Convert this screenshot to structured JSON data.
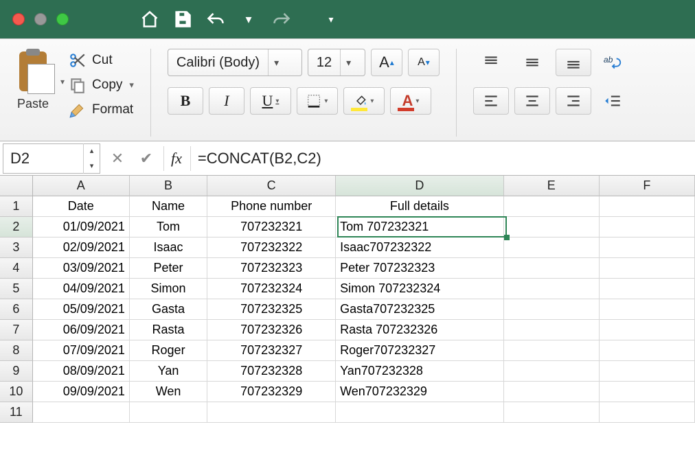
{
  "titlebar": {},
  "ribbon": {
    "paste_label": "Paste",
    "cut_label": "Cut",
    "copy_label": "Copy",
    "format_label": "Format",
    "font_name": "Calibri (Body)",
    "font_size": "12",
    "bold": "B",
    "italic": "I",
    "underline": "U",
    "font_color_letter": "A",
    "increase_A": "A",
    "decrease_A": "A"
  },
  "formula_bar": {
    "name_box": "D2",
    "fx_label": "fx",
    "formula": "=CONCAT(B2,C2)"
  },
  "grid": {
    "columns": [
      "A",
      "B",
      "C",
      "D",
      "E",
      "F"
    ],
    "active_column_index": 3,
    "active_row": 2,
    "selected_cell": "D2",
    "headers": {
      "A": "Date",
      "B": "Name",
      "C": "Phone number",
      "D": "Full details",
      "E": "",
      "F": ""
    },
    "rows": [
      {
        "n": 1
      },
      {
        "n": 2,
        "A": "01/09/2021",
        "B": "Tom",
        "C": "707232321",
        "D": "Tom 707232321"
      },
      {
        "n": 3,
        "A": "02/09/2021",
        "B": "Isaac",
        "C": "707232322",
        "D": "Isaac707232322"
      },
      {
        "n": 4,
        "A": "03/09/2021",
        "B": "Peter",
        "C": "707232323",
        "D": "Peter 707232323"
      },
      {
        "n": 5,
        "A": "04/09/2021",
        "B": "Simon",
        "C": "707232324",
        "D": "Simon 707232324"
      },
      {
        "n": 6,
        "A": "05/09/2021",
        "B": "Gasta",
        "C": "707232325",
        "D": "Gasta707232325"
      },
      {
        "n": 7,
        "A": "06/09/2021",
        "B": "Rasta",
        "C": "707232326",
        "D": "Rasta 707232326"
      },
      {
        "n": 8,
        "A": "07/09/2021",
        "B": "Roger",
        "C": "707232327",
        "D": "Roger707232327"
      },
      {
        "n": 9,
        "A": "08/09/2021",
        "B": "Yan",
        "C": "707232328",
        "D": "Yan707232328"
      },
      {
        "n": 10,
        "A": "09/09/2021",
        "B": "Wen",
        "C": "707232329",
        "D": "Wen707232329"
      },
      {
        "n": 11
      }
    ]
  }
}
